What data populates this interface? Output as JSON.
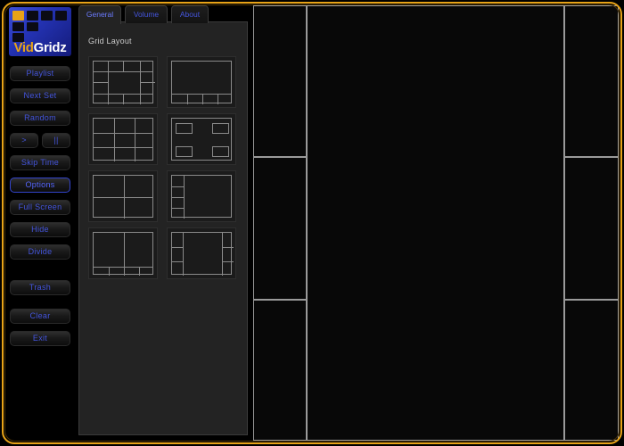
{
  "app": {
    "name": "VidGridz",
    "logo": {
      "text_primary": "Vid",
      "text_secondary": "Gridz",
      "accent_color": "#e8a317",
      "background_color": "#2433b4"
    },
    "frame_color": "#e8a317"
  },
  "sidebar": {
    "buttons": [
      {
        "label": "Playlist",
        "name": "playlist",
        "state": "normal"
      },
      {
        "label": "Next Set",
        "name": "next-set",
        "state": "normal"
      },
      {
        "label": "Random",
        "name": "random",
        "state": "normal"
      },
      {
        "label": ">",
        "name": "play",
        "state": "normal"
      },
      {
        "label": "||",
        "name": "pause",
        "state": "normal"
      },
      {
        "label": "Skip Time",
        "name": "skip-time",
        "state": "normal"
      },
      {
        "label": "Options",
        "name": "options",
        "state": "active"
      },
      {
        "label": "Full Screen",
        "name": "full-screen",
        "state": "normal"
      },
      {
        "label": "Hide",
        "name": "hide",
        "state": "normal"
      },
      {
        "label": "Divide",
        "name": "divide",
        "state": "normal"
      },
      {
        "label": "Trash",
        "name": "trash",
        "state": "normal"
      },
      {
        "label": "Clear",
        "name": "clear",
        "state": "normal"
      },
      {
        "label": "Exit",
        "name": "exit",
        "state": "normal"
      }
    ]
  },
  "options_panel": {
    "tabs": [
      {
        "label": "General",
        "active": true
      },
      {
        "label": "Volume",
        "active": false
      },
      {
        "label": "About",
        "active": false
      }
    ],
    "section_label": "Grid Layout",
    "layout_presets": [
      {
        "index": 1,
        "name": "frame-border-layout",
        "description": "Ring of cells surrounding one large center cell"
      },
      {
        "index": 2,
        "name": "large-top-strip-bottom",
        "description": "One large cell above a strip of four small cells"
      },
      {
        "index": 3,
        "name": "grid-3x3",
        "description": "Uniform three by three grid"
      },
      {
        "index": 4,
        "name": "four-corners",
        "description": "Four small cells in the corners"
      },
      {
        "index": 5,
        "name": "grid-2x2",
        "description": "Uniform two by two grid"
      },
      {
        "index": 6,
        "name": "left-column-large-right",
        "description": "Column of four cells at left, large cell at right"
      },
      {
        "index": 7,
        "name": "two-top-strip-bottom",
        "description": "Two large cells above a strip of four small cells"
      },
      {
        "index": 8,
        "name": "side-columns-center",
        "description": "Columns of cells on both sides with large center cell"
      }
    ]
  },
  "video_grid": {
    "active_layout": "side-columns-center",
    "cells": [
      {
        "name": "left-cell-1"
      },
      {
        "name": "left-cell-2"
      },
      {
        "name": "left-cell-3"
      },
      {
        "name": "center-cell"
      },
      {
        "name": "right-cell-1"
      },
      {
        "name": "right-cell-2"
      },
      {
        "name": "right-cell-3"
      }
    ]
  }
}
